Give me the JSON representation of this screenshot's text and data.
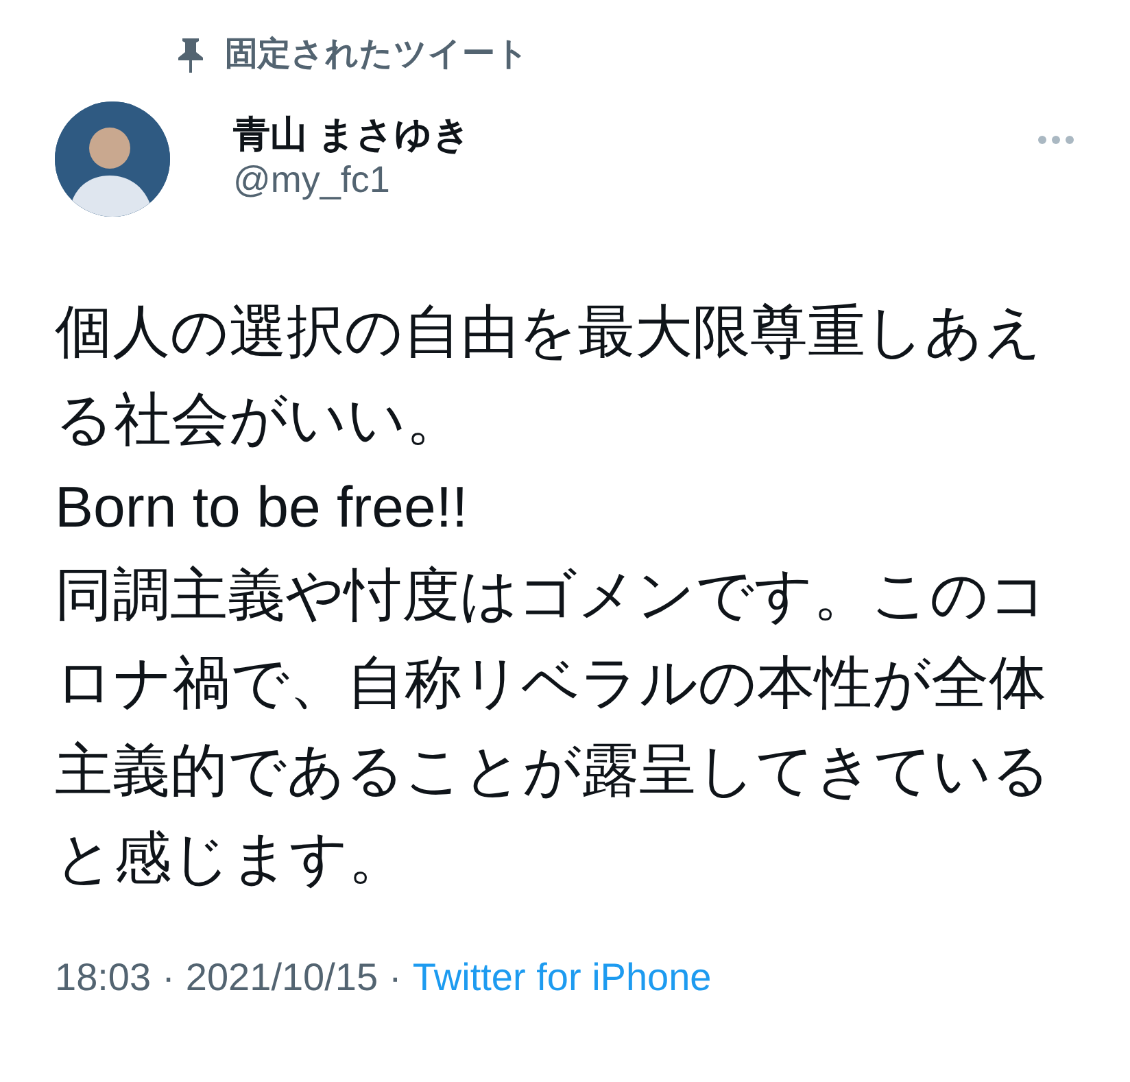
{
  "pinned": {
    "label": "固定されたツイート"
  },
  "author": {
    "name": "青山 まさゆき",
    "handle": "@my_fc1"
  },
  "tweet": {
    "paragraphs": [
      "個人の選択の自由を最大限尊重しあえる社会がいい。",
      "Born to be free!!",
      "同調主義や忖度はゴメンです。このコロナ禍で、自称リベラルの本性が全体主義的であることが露呈してきていると感じます。"
    ]
  },
  "meta": {
    "time": "18:03",
    "separator_1": "·",
    "date": "2021/10/15",
    "separator_2": "·",
    "source": "Twitter for iPhone"
  }
}
